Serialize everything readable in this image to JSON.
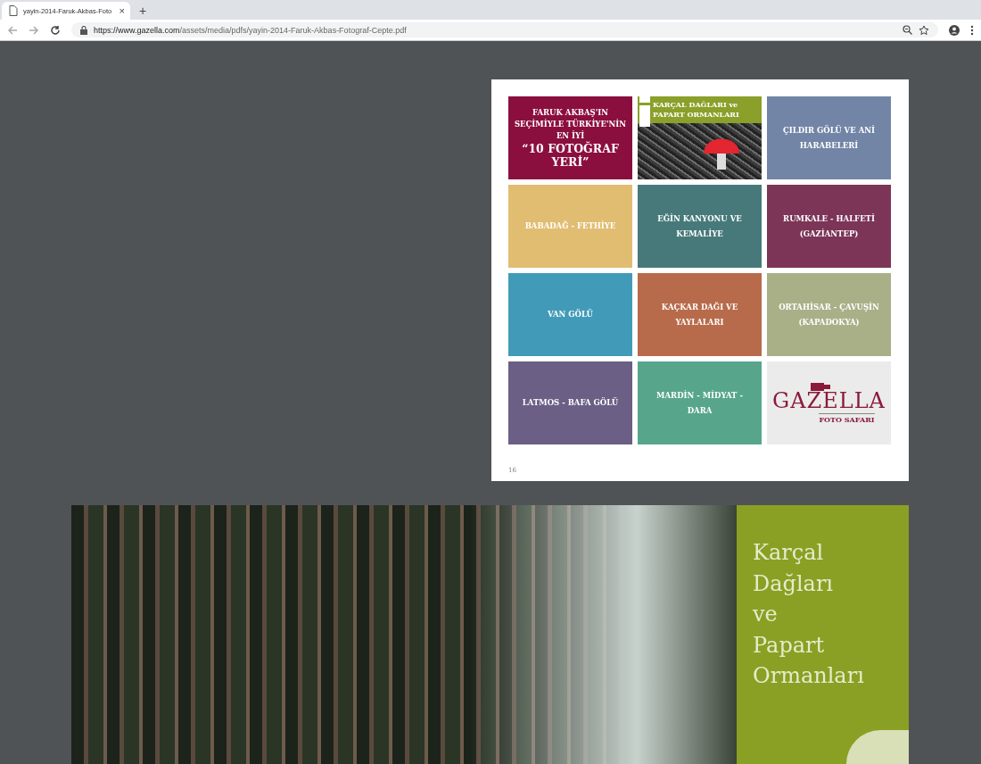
{
  "browser": {
    "tab_title": "yayin-2014-Faruk-Akbas-Foto",
    "tab_close": "×",
    "new_tab": "+",
    "url_host": "https://www.gazella.com",
    "url_path": "/assets/media/pdfs/yayin-2014-Faruk-Akbas-Fotograf-Cepte.pdf"
  },
  "page_1": {
    "tiles": [
      {
        "kind": "title",
        "color": "#8b0f3e",
        "top": "FARUK AKBAŞ'IN SEÇİMİYLE TÜRKİYE'NİN EN İYİ",
        "emphasis": "“10 FOTOĞRAF YERİ”"
      },
      {
        "kind": "photo",
        "color": "#8aa02a",
        "label": "KARÇAL DAĞLARI ve PAPART ORMANLARI"
      },
      {
        "kind": "place",
        "color": "#7285a6",
        "label": "ÇILDIR GÖLÜ VE ANİ HARABELERİ"
      },
      {
        "kind": "place",
        "color": "#e1bd72",
        "label": "BABADAĞ - FETHİYE"
      },
      {
        "kind": "place",
        "color": "#47797a",
        "label": "EĞİN KANYONU VE KEMALİYE"
      },
      {
        "kind": "place",
        "color": "#7c3457",
        "label": "RUMKALE - HALFETİ (GAZİANTEP)"
      },
      {
        "kind": "place",
        "color": "#419bb8",
        "label": "VAN GÖLÜ"
      },
      {
        "kind": "place",
        "color": "#b86b4b",
        "label": "KAÇKAR DAĞI VE YAYLALARI"
      },
      {
        "kind": "place",
        "color": "#a9b088",
        "label": "ORTAHİSAR - ÇAVUŞİN (KAPADOKYA)"
      },
      {
        "kind": "place",
        "color": "#6b5f85",
        "label": "LATMOS - BAFA GÖLÜ"
      },
      {
        "kind": "place",
        "color": "#57a68c",
        "label": "MARDİN - MİDYAT - DARA"
      },
      {
        "kind": "logo",
        "color": "#ebebeb",
        "label": "GAZELLA",
        "tagline": "FOTO SAFARI"
      }
    ],
    "page_number": "16"
  },
  "page_2": {
    "heading": "Karçal Dağları ve Papart Ormanları"
  }
}
